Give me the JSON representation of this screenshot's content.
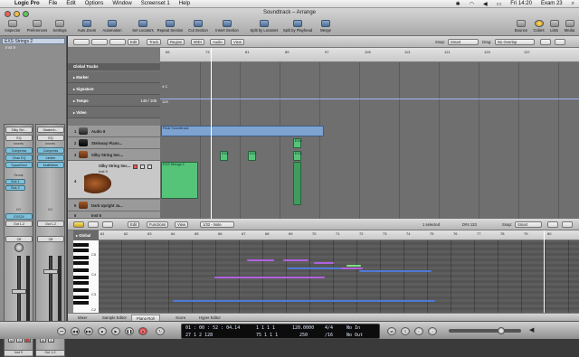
{
  "menubar": {
    "app": "Logic Pro",
    "items": [
      "File",
      "Edit",
      "Options",
      "Window",
      "Screenset 1",
      "Help"
    ],
    "clock": "Fri 14:20",
    "user": "Exam 23"
  },
  "window": {
    "title": "Soundtrack – Arrange",
    "toolbar_left": [
      "Inspector",
      "Preferences",
      "Settings"
    ],
    "toolbar_mid": [
      "Auto Zoom",
      "Automation",
      "Set Locators",
      "Repeat Section",
      "Cut Section",
      "Insert Section",
      "Split by Locators",
      "Split by Playhead",
      "Merge"
    ],
    "toolbar_right": [
      "Bounce",
      "Colors",
      "Lists",
      "Media"
    ]
  },
  "inspector": {
    "region_name": "EXS Strings 2",
    "sub": "Inst 9",
    "strip1": {
      "setting": "Silky Stri...",
      "eq": "EQ",
      "inserts_label": "Inserts",
      "inserts": [
        "Compress",
        "Chan EQ",
        "SpaceDesi"
      ],
      "sends_label": "Sends",
      "sends": [
        "Bus 1",
        "Bus 2"
      ],
      "io_label": "I/O",
      "input": "EXS24",
      "output": "Out 1-2",
      "automation": "Off",
      "volume": "-16.7",
      "name": "Inst 9"
    },
    "strip2": {
      "setting": "Masterin...",
      "eq": "EQ",
      "inserts_label": "Inserts",
      "inserts": [
        "Compress",
        "Limiter",
        "MultiMeter"
      ],
      "io_label": "I/O",
      "output": "Out 1-2",
      "automation": "Off",
      "volume": "0.0",
      "name": "Out 1-2"
    }
  },
  "arrange": {
    "menus": [
      "Edit",
      "Track",
      "Region",
      "MIDI",
      "Audio",
      "View"
    ],
    "snap_label": "Snap:",
    "snap_value": "Smart",
    "drag_label": "Drag:",
    "drag_value": "No Overlap",
    "global_tracks_label": "Global Tracks",
    "global_rows": [
      {
        "name": "Marker",
        "value": ""
      },
      {
        "name": "Signature",
        "value": "4/4"
      },
      {
        "name": "Tempo",
        "value": "148 / 108"
      },
      {
        "name": "Video",
        "value": ""
      }
    ],
    "signature_text": "4  C",
    "tempo_text": "129",
    "ruler_ticks": [
      "65",
      "73",
      "81",
      "89",
      "97",
      "105",
      "113",
      "121",
      "129",
      "137"
    ],
    "tracks": [
      {
        "num": "1",
        "name": "Audio 8"
      },
      {
        "num": "2",
        "name": "Steinway Piano..."
      },
      {
        "num": "3",
        "name": "Silky String Sec..."
      },
      {
        "num": "4",
        "name": "Silky String Sec...",
        "sub": "Inst 9"
      },
      {
        "num": "5",
        "name": "Dark Upright Ja..."
      },
      {
        "num": "6",
        "name": "Inst 6"
      }
    ],
    "regions": {
      "audio": "Final Soundtrack",
      "exs": "EXS Strings 2",
      "small1": "EXS",
      "small2": "EXS",
      "small3": "EXS",
      "small4": "EXS"
    }
  },
  "piano_roll": {
    "menus": [
      "Edit",
      "Functions",
      "View"
    ],
    "quant": "1/32 - Note",
    "selected": "1 selected",
    "position": "D#4  133",
    "snap_label": "Snap:",
    "snap_value": "Smart",
    "global_label": "Global Tracks",
    "key_labels": [
      "C5",
      "C4",
      "C3",
      "C2"
    ],
    "ruler_ticks": [
      "61",
      "62",
      "63",
      "64",
      "65",
      "66",
      "67",
      "68",
      "69",
      "70",
      "71",
      "72",
      "73",
      "74",
      "75",
      "76",
      "77",
      "78",
      "79",
      "80"
    ]
  },
  "bottom_tabs": [
    "Mixer",
    "Sample Editor",
    "Piano Roll",
    "Score",
    "Hyper Editor"
  ],
  "active_tab": "Piano Roll",
  "transport": {
    "smpte": "01 : 00 : 52 : 04.14",
    "bars": "27    1    2    128",
    "pos": "1    1    1    1",
    "end": "75    1    1    1",
    "tempo": "120.0000",
    "tempo2": "250",
    "sig": "4/4",
    "div": "/16",
    "in": "No In",
    "out": "No Out"
  },
  "colors": {
    "region_green": "#55c479",
    "region_blue": "#7ea3d1",
    "note_blue": "#4f79d6",
    "note_purple": "#b061e0",
    "note_green": "#7be07b"
  }
}
